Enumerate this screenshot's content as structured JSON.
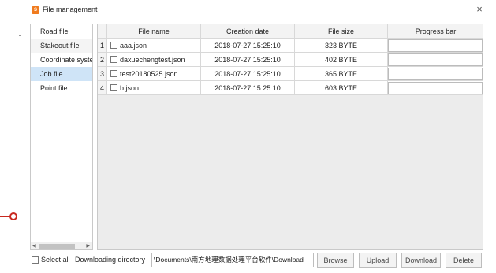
{
  "window": {
    "title": "File management",
    "icon": "app-logo-icon",
    "close_label": "×"
  },
  "sidebar": {
    "items": [
      {
        "label": "Road file"
      },
      {
        "label": "Stakeout file"
      },
      {
        "label": "Coordinate system file"
      },
      {
        "label": "Job file",
        "selected": true
      },
      {
        "label": "Point file"
      }
    ]
  },
  "table": {
    "columns": [
      "File name",
      "Creation date",
      "File size",
      "Progress bar"
    ],
    "rows": [
      {
        "num": "1",
        "name": "aaa.json",
        "date": "2018-07-27 15:25:10",
        "size": "323 BYTE",
        "progress": 0
      },
      {
        "num": "2",
        "name": "daxuechengtest.json",
        "date": "2018-07-27 15:25:10",
        "size": "402 BYTE",
        "progress": 0
      },
      {
        "num": "3",
        "name": "test20180525.json",
        "date": "2018-07-27 15:25:10",
        "size": "365 BYTE",
        "progress": 0
      },
      {
        "num": "4",
        "name": "b.json",
        "date": "2018-07-27 15:25:10",
        "size": "603 BYTE",
        "progress": 0
      }
    ]
  },
  "footer": {
    "select_all_label": "Select all",
    "download_dir_label": "Downloading directory",
    "download_dir_value": "\\Documents\\南方地理数据处理平台软件\\Download",
    "browse_label": "Browse",
    "upload_label": "Upload",
    "download_label": "Download",
    "delete_label": "Delete"
  },
  "colors": {
    "selection": "#cfe4f7",
    "accent_orange": "#f07b1e",
    "marker_red": "#c8281f"
  }
}
